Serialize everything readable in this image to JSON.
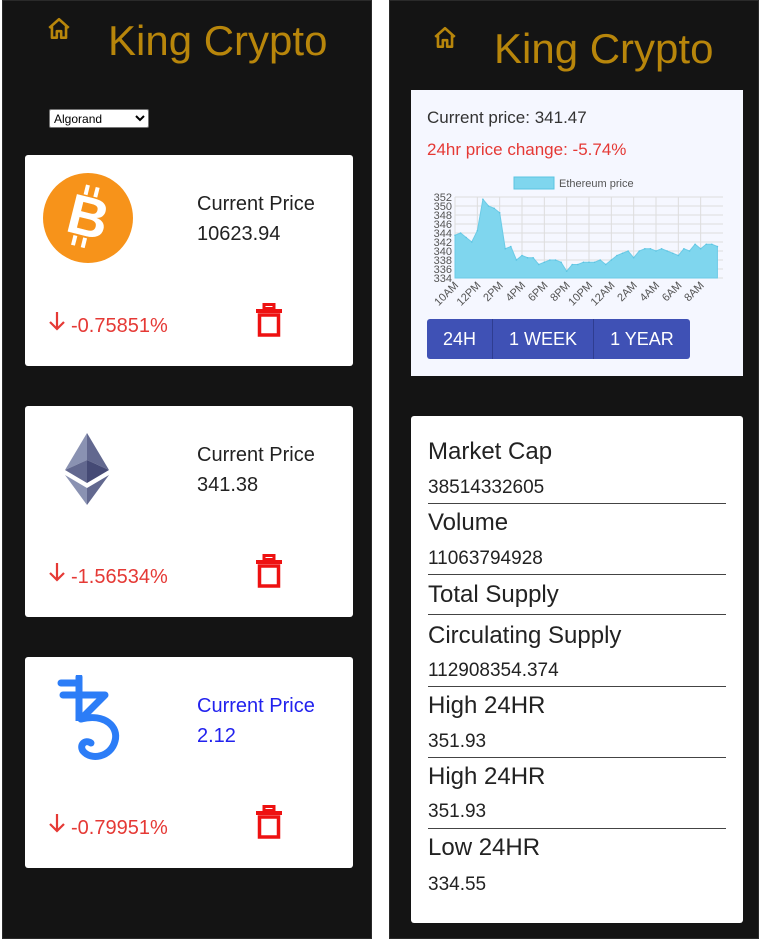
{
  "app": {
    "title": "King Crypto"
  },
  "selector": {
    "selected": "Algorand"
  },
  "coins": [
    {
      "logo": "bitcoin-logo",
      "price_label": "Current Price",
      "price": "10623.94",
      "change": "-0.75851%",
      "change_icon": "arrow-down-icon",
      "delete_icon": "trash-icon"
    },
    {
      "logo": "ethereum-logo",
      "price_label": "Current Price",
      "price": "341.38",
      "change": "-1.56534%",
      "change_icon": "arrow-down-icon",
      "delete_icon": "trash-icon"
    },
    {
      "logo": "tezos-logo",
      "price_label": "Current Price",
      "price": "2.12",
      "change": "-0.79951%",
      "change_icon": "arrow-down-icon",
      "delete_icon": "trash-icon"
    }
  ],
  "detail": {
    "current_price": "Current price: 341.47",
    "change_24h": "24hr price change: -5.74%",
    "range_buttons": [
      "24H",
      "1 WEEK",
      "1 YEAR"
    ]
  },
  "stats": [
    {
      "label": "Market Cap",
      "value": "38514332605"
    },
    {
      "label": "Volume",
      "value": "11063794928"
    },
    {
      "label": "Total Supply",
      "value": ""
    },
    {
      "label": "Circulating Supply",
      "value": "112908354.374"
    },
    {
      "label": "High 24HR",
      "value": "351.93"
    },
    {
      "label": "High 24HR",
      "value": "351.93"
    },
    {
      "label": "Low 24HR",
      "value": "334.55"
    }
  ],
  "colors": {
    "title": "#b8860b",
    "negative": "#e53935",
    "button": "#3f51b5",
    "chart_fill": "#7fd6ee",
    "blue_text": "#2222ee"
  },
  "chart_data": {
    "type": "area",
    "legend": "Ethereum price",
    "legend_position": "top-center",
    "ylim": [
      334,
      352
    ],
    "y_ticks": [
      "352",
      "350",
      "348",
      "346",
      "344",
      "342",
      "340",
      "338",
      "336",
      "334"
    ],
    "x_ticks": [
      "10AM",
      "12PM",
      "2PM",
      "4PM",
      "6PM",
      "8PM",
      "10PM",
      "12AM",
      "2AM",
      "4AM",
      "6AM",
      "8AM"
    ],
    "grid": true,
    "series": [
      {
        "name": "Ethereum price",
        "x_hours": [
          0,
          0.5,
          1,
          1.5,
          2,
          2.5,
          3,
          3.5,
          4,
          4.5,
          5,
          5.5,
          6,
          6.5,
          7,
          7.5,
          8,
          8.5,
          9,
          9.5,
          10,
          10.5,
          11,
          11.5,
          12,
          12.5,
          13,
          13.5,
          14,
          14.5,
          15,
          15.5,
          16,
          16.5,
          17,
          17.5,
          18,
          18.5,
          19,
          19.5,
          20,
          20.5,
          21,
          21.5,
          22,
          22.5,
          23,
          23.5
        ],
        "values": [
          343.5,
          344,
          343,
          342,
          344.5,
          351.5,
          350,
          349.5,
          348.5,
          340.5,
          341,
          338,
          339,
          338.5,
          338.5,
          337,
          337.5,
          338,
          338,
          337.5,
          335.5,
          337,
          337,
          337.5,
          337.5,
          337.5,
          338,
          337,
          338,
          339,
          339.5,
          340,
          338.5,
          340,
          340.5,
          340.5,
          340,
          340.5,
          340,
          339.5,
          339,
          340.5,
          340,
          341.5,
          340.5,
          341.5,
          341.5,
          341
        ]
      }
    ]
  }
}
